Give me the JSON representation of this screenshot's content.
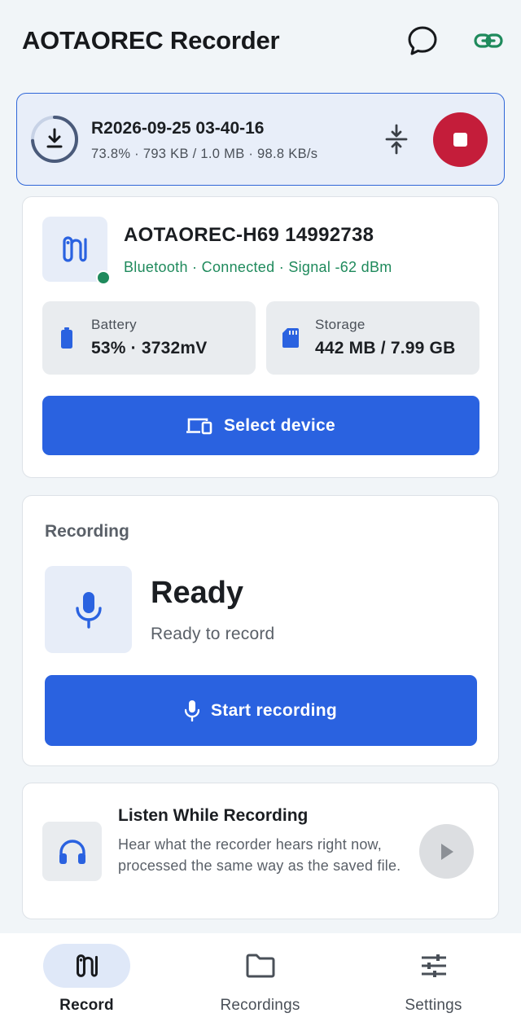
{
  "app": {
    "title": "AOTAOREC Recorder"
  },
  "header": {
    "chat_icon": "chat-bubble-icon",
    "link_icon": "link-icon"
  },
  "transfer": {
    "title": "R2026-09-25 03-40-16",
    "progress_text": "73.8% · 793 KB / 1.0 MB · 98.8 KB/s",
    "progress": 0.738,
    "colors": {
      "accent": "#2f66d8",
      "stop": "#c41d3a"
    }
  },
  "device": {
    "name": "AOTAOREC-H69 14992738",
    "status": "Bluetooth · Connected · Signal -62 dBm",
    "connected_color": "#1f8a5c",
    "battery": {
      "label": "Battery",
      "value": "53% · 3732mV"
    },
    "storage": {
      "label": "Storage",
      "value": "442 MB / 7.99 GB"
    },
    "select_button": "Select device"
  },
  "recording": {
    "section_label": "Recording",
    "state": "Ready",
    "sub": "Ready to record",
    "start_button": "Start recording"
  },
  "listen": {
    "title": "Listen While Recording",
    "description": "Hear what the recorder hears right now, processed the same way as the saved file."
  },
  "nav": {
    "items": [
      {
        "label": "Record",
        "icon": "recorder-icon",
        "active": true
      },
      {
        "label": "Recordings",
        "icon": "folder-icon",
        "active": false
      },
      {
        "label": "Settings",
        "icon": "sliders-icon",
        "active": false
      }
    ]
  }
}
